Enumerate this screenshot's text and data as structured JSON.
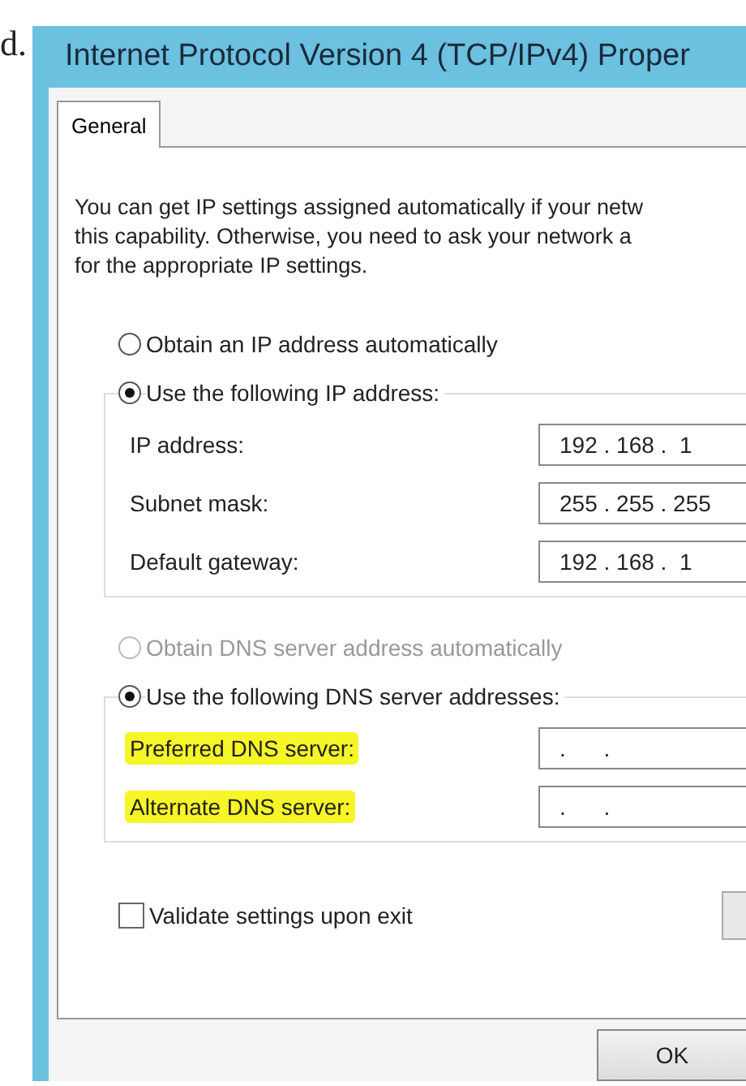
{
  "margin_text": "d.",
  "window": {
    "title": "Internet Protocol Version 4 (TCP/IPv4) Proper"
  },
  "tabs": [
    {
      "label": "General",
      "selected": true
    }
  ],
  "intro": [
    "You can get IP settings assigned automatically if your netw",
    "this capability. Otherwise, you need to ask your network a",
    "for the appropriate IP settings."
  ],
  "ip_section": {
    "options": [
      {
        "label": "Obtain an IP address automatically",
        "selected": false,
        "disabled": false
      },
      {
        "label": "Use the following IP address:",
        "selected": true,
        "disabled": false
      }
    ],
    "fields": [
      {
        "label": "IP address:",
        "value": "192 . 168 .  1",
        "highlighted": false
      },
      {
        "label": "Subnet mask:",
        "value": "255 . 255 . 255",
        "highlighted": false
      },
      {
        "label": "Default gateway:",
        "value": "192 . 168 .  1",
        "highlighted": false
      }
    ]
  },
  "dns_section": {
    "options": [
      {
        "label": "Obtain DNS server address automatically",
        "selected": false,
        "disabled": true
      },
      {
        "label": "Use the following DNS server addresses:",
        "selected": true,
        "disabled": false
      }
    ],
    "fields": [
      {
        "label": "Preferred DNS server:",
        "value": ".      .",
        "highlighted": true
      },
      {
        "label": "Alternate DNS server:",
        "value": ".      .",
        "highlighted": true
      }
    ]
  },
  "validate": {
    "label": "Validate settings upon exit",
    "checked": false
  },
  "buttons": [
    "OK"
  ]
}
